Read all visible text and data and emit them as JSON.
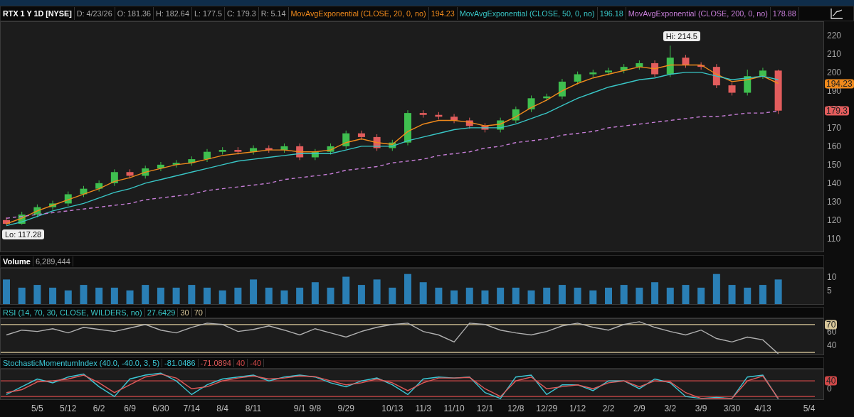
{
  "panes": [
    {
      "kind": "price",
      "legend": [
        {
          "kind": "title",
          "text": "RTX 1 Y 1D [NYSE]"
        },
        {
          "kind": "field",
          "text": "D: 4/23/26"
        },
        {
          "kind": "field",
          "text": "O: 181.36"
        },
        {
          "kind": "field",
          "text": "H: 182.64"
        },
        {
          "kind": "field",
          "text": "L: 177.5"
        },
        {
          "kind": "field",
          "text": "C: 179.3"
        },
        {
          "kind": "field",
          "text": "R: 5.14"
        },
        {
          "kind": "series",
          "text": "MovAvgExponential (CLOSE, 20, 0, no)"
        },
        {
          "kind": "value",
          "text": "194.23"
        },
        {
          "kind": "series",
          "text": "MovAvgExponential (CLOSE, 50, 0, no)"
        },
        {
          "kind": "value",
          "text": "196.18"
        },
        {
          "kind": "series",
          "text": "MovAvgExponential (CLOSE, 200, 0, no)"
        },
        {
          "kind": "value",
          "text": "178.88"
        }
      ],
      "chart_data": {
        "type": "candlestick",
        "ylim": [
          103,
          227.3
        ],
        "yticks": [
          110,
          120,
          130,
          140,
          150,
          160,
          170,
          180,
          190,
          200,
          210,
          220
        ],
        "categories": [
          null,
          null,
          null,
          null,
          null,
          null,
          null,
          null,
          null,
          null,
          null,
          null,
          null,
          null,
          null,
          null,
          null,
          null,
          null,
          null,
          null,
          null,
          null,
          null,
          null,
          null,
          null,
          null,
          null,
          null,
          null,
          null,
          null,
          null,
          null,
          null,
          null,
          null,
          null,
          null,
          null,
          null,
          null,
          null,
          null,
          null,
          null,
          null,
          null,
          null,
          null,
          null,
          null
        ],
        "ohlc": [
          [
            120,
            121.5,
            117.28,
            118
          ],
          [
            118,
            124.5,
            117.5,
            123
          ],
          [
            123,
            128.5,
            121.5,
            127
          ],
          [
            127,
            130.5,
            125.5,
            129
          ],
          [
            129,
            135.5,
            127.5,
            134
          ],
          [
            134,
            138.5,
            132.5,
            137
          ],
          [
            137,
            141.5,
            135.5,
            140
          ],
          [
            140,
            147.5,
            138.5,
            146
          ],
          [
            146,
            147.5,
            142.5,
            144
          ],
          [
            144,
            149.5,
            142.5,
            148
          ],
          [
            148,
            151.5,
            146.5,
            150
          ],
          [
            150,
            152.5,
            148.5,
            151
          ],
          [
            151,
            154.5,
            149.5,
            153
          ],
          [
            153,
            158.5,
            151.5,
            157
          ],
          [
            157,
            159.5,
            155.5,
            158
          ],
          [
            158,
            159.5,
            155.5,
            157
          ],
          [
            157,
            160.5,
            155.5,
            159
          ],
          [
            159,
            160.5,
            156.5,
            158
          ],
          [
            158,
            161.5,
            156.5,
            160
          ],
          [
            160,
            161.5,
            152.5,
            154
          ],
          [
            154,
            158.5,
            152.5,
            157
          ],
          [
            157,
            161.5,
            155.5,
            160
          ],
          [
            160,
            168.5,
            158.5,
            167
          ],
          [
            167,
            168.5,
            163.5,
            165
          ],
          [
            165,
            166.5,
            157.5,
            159
          ],
          [
            159,
            163.5,
            157.5,
            162
          ],
          [
            162,
            179.5,
            160.5,
            178
          ],
          [
            178,
            179.5,
            175.5,
            177
          ],
          [
            177,
            178.5,
            174.5,
            176
          ],
          [
            176,
            177.5,
            172.5,
            174
          ],
          [
            174,
            175.5,
            169.5,
            171
          ],
          [
            171,
            172.5,
            167.5,
            169
          ],
          [
            169,
            175.5,
            167.5,
            174
          ],
          [
            174,
            181.5,
            172.5,
            180
          ],
          [
            180,
            187.5,
            178.5,
            186
          ],
          [
            186,
            188.5,
            184.5,
            187
          ],
          [
            187,
            196.5,
            185.5,
            195
          ],
          [
            195,
            200.5,
            193.5,
            199
          ],
          [
            199,
            201.5,
            197.5,
            200
          ],
          [
            200,
            202.5,
            198.5,
            201
          ],
          [
            201,
            204.5,
            199.5,
            203
          ],
          [
            203,
            206.5,
            201.5,
            205
          ],
          [
            205,
            206.5,
            197.5,
            199
          ],
          [
            199,
            214.5,
            197.5,
            208
          ],
          [
            208,
            209.5,
            202.5,
            204
          ],
          [
            204,
            205.5,
            201.5,
            203
          ],
          [
            203,
            204.5,
            191.5,
            193
          ],
          [
            193,
            194.5,
            187.5,
            189
          ],
          [
            189,
            201.5,
            187.5,
            198
          ],
          [
            198,
            202.5,
            196.5,
            201
          ],
          [
            201,
            201.5,
            177.5,
            179.3
          ],
          null,
          null
        ],
        "annotations": [
          "Hi: 214.5",
          "Lo: 117.28",
          "194.23",
          "179.3"
        ]
      },
      "moving_averages": {
        "chart_data": {
          "type": "line",
          "ylim": [
            103,
            227.3
          ],
          "categories": [
            null,
            null,
            null,
            null,
            null,
            null,
            null,
            null,
            null,
            null,
            null,
            null,
            null,
            null,
            null,
            null,
            null,
            null,
            null,
            null,
            null,
            null,
            null,
            null,
            null,
            null,
            null,
            null,
            null,
            null,
            null,
            null,
            null,
            null,
            null,
            null,
            null,
            null,
            null,
            null,
            null,
            null,
            null,
            null,
            null,
            null,
            null,
            null,
            null,
            null,
            null,
            null,
            null
          ],
          "series": [
            {
              "color": "#f08a1c",
              "values": [
                118,
                121,
                125,
                128,
                131,
                134,
                137,
                141,
                143,
                146,
                148,
                150,
                151,
                153,
                155,
                156,
                157,
                158,
                158,
                157,
                157,
                158,
                162,
                164,
                162,
                161,
                168,
                172,
                174,
                174,
                173,
                171,
                172,
                176,
                181,
                185,
                190,
                194,
                197,
                199,
                201,
                203,
                202,
                204,
                204,
                204,
                199,
                195,
                196,
                198,
                194,
                null,
                null
              ]
            },
            {
              "color": "#39c6c6",
              "values": [
                117,
                119,
                122,
                125,
                127,
                129,
                132,
                135,
                137,
                140,
                142,
                144,
                146,
                148,
                150,
                152,
                153,
                154,
                155,
                156,
                156,
                156,
                158,
                160,
                160,
                160,
                163,
                165,
                167,
                169,
                170,
                170,
                170,
                172,
                175,
                178,
                182,
                186,
                189,
                192,
                194,
                196,
                197,
                199,
                200,
                200,
                198,
                196,
                197,
                198,
                196,
                null,
                null
              ]
            },
            {
              "color": "#c77ed8",
              "line_style": "dashed",
              "values": [
                121,
                122,
                123,
                124,
                125,
                126,
                127,
                128,
                129,
                131,
                132,
                133,
                134,
                136,
                137,
                138,
                139,
                140,
                142,
                143,
                144,
                145,
                147,
                148,
                149,
                151,
                152,
                153,
                155,
                156,
                157,
                159,
                160,
                162,
                163,
                164,
                166,
                167,
                168,
                170,
                171,
                172,
                173,
                174,
                175,
                176,
                176,
                177,
                178,
                178,
                179,
                null,
                null
              ]
            }
          ]
        }
      }
    },
    {
      "kind": "volume",
      "legend": [
        {
          "kind": "title",
          "text": "Volume"
        },
        {
          "kind": "field",
          "text": "6,289,444"
        }
      ],
      "chart_data": {
        "type": "bar",
        "ylim": [
          0,
          13
        ],
        "yticks": [
          5,
          10
        ],
        "categories": [
          null,
          null,
          null,
          null,
          null,
          null,
          null,
          null,
          null,
          null,
          null,
          null,
          null,
          null,
          null,
          null,
          null,
          null,
          null,
          null,
          null,
          null,
          null,
          null,
          null,
          null,
          null,
          null,
          null,
          null,
          null,
          null,
          null,
          null,
          null,
          null,
          null,
          null,
          null,
          null,
          null,
          null,
          null,
          null,
          null,
          null,
          null,
          null,
          null,
          null,
          null,
          null,
          null
        ],
        "series": [
          {
            "color": "#2a7fb5",
            "values": [
              9,
              6,
              7,
              6,
              5,
              7,
              6,
              6,
              5,
              7,
              6,
              6,
              7,
              6,
              5,
              6,
              9,
              6,
              5,
              6,
              8,
              6,
              10,
              7,
              9,
              6,
              11,
              8,
              6,
              5,
              6,
              5,
              6,
              6,
              5,
              6,
              7,
              6,
              5,
              6,
              7,
              6,
              8,
              6,
              7,
              6,
              11,
              7,
              6,
              7,
              9,
              null,
              null
            ]
          }
        ]
      }
    },
    {
      "kind": "rsi",
      "legend": [
        {
          "kind": "accent",
          "text": "RSI (14, 70, 30, CLOSE, WILDERS, no)"
        },
        {
          "kind": "accent",
          "text": "27.6429"
        },
        {
          "kind": "ref"
        },
        {
          "kind": "ref"
        }
      ],
      "chart_data": {
        "type": "line",
        "ylim": [
          27,
          78
        ],
        "yticks": [
          40,
          60,
          70
        ],
        "categories": [
          null,
          null,
          null,
          null,
          null,
          null,
          null,
          null,
          null,
          null,
          null,
          null,
          null,
          null,
          null,
          null,
          null,
          null,
          null,
          null,
          null,
          null,
          null,
          null,
          null,
          null,
          null,
          null,
          null,
          null,
          null,
          null,
          null,
          null,
          null,
          null,
          null,
          null,
          null,
          null,
          null,
          null,
          null,
          null,
          null,
          null,
          null,
          null,
          null,
          null,
          null,
          null,
          null
        ],
        "series": [
          {
            "color": "#b0b0b0",
            "values": [
              55,
              62,
              60,
              64,
              58,
              66,
              63,
              60,
              65,
              70,
              62,
              58,
              66,
              72,
              70,
              60,
              63,
              68,
              62,
              55,
              64,
              58,
              52,
              60,
              66,
              70,
              72,
              60,
              55,
              45,
              72,
              70,
              62,
              58,
              55,
              60,
              68,
              72,
              66,
              62,
              70,
              74,
              66,
              60,
              55,
              62,
              50,
              45,
              52,
              48,
              28,
              null,
              null
            ]
          }
        ],
        "ref_lines": [
          {
            "axis": "y",
            "value": 30,
            "label": "30",
            "color": "#d8c79a"
          },
          {
            "axis": "y",
            "value": 70,
            "label": "70",
            "color": "#d8c79a"
          }
        ]
      }
    },
    {
      "kind": "smi",
      "legend": [
        {
          "kind": "series",
          "text": "StochasticMomentumIndex (40.0, -40.0, 3, 5)"
        },
        {
          "kind": "value",
          "text": "-81.0486"
        },
        {
          "kind": "value",
          "text": "-71.0894"
        },
        {
          "kind": "ref"
        },
        {
          "kind": "ref"
        }
      ],
      "chart_data": {
        "type": "line",
        "ylim": [
          -54,
          99
        ],
        "yticks": [
          0,
          40
        ],
        "categories": [
          null,
          null,
          "5/5",
          null,
          "5/12",
          null,
          "6/2",
          null,
          "6/9",
          null,
          "6/30",
          null,
          "7/14",
          null,
          "8/4",
          null,
          "8/11",
          null,
          null,
          "9/1",
          "9/8",
          null,
          "9/29",
          null,
          null,
          "10/13",
          null,
          "11/3",
          null,
          "11/10",
          null,
          "12/1",
          null,
          "12/8",
          null,
          "12/29",
          null,
          "1/12",
          null,
          "2/2",
          null,
          "2/9",
          null,
          "3/2",
          null,
          "3/9",
          null,
          "3/30",
          null,
          "4/13",
          null,
          null,
          "5/4"
        ],
        "series": [
          {
            "color": "#3cc8d6",
            "values": [
              -30,
              10,
              50,
              30,
              60,
              75,
              10,
              -40,
              50,
              70,
              80,
              40,
              -30,
              20,
              50,
              60,
              70,
              40,
              60,
              70,
              60,
              30,
              10,
              40,
              55,
              20,
              -30,
              50,
              60,
              55,
              60,
              -20,
              -50,
              60,
              70,
              -30,
              20,
              20,
              -10,
              40,
              40,
              0,
              50,
              30,
              -40,
              -50,
              -45,
              -50,
              60,
              70,
              -52,
              null,
              null
            ]
          },
          {
            "color": "#e05a5a",
            "values": [
              -20,
              -5,
              35,
              40,
              50,
              70,
              30,
              -20,
              20,
              60,
              75,
              55,
              0,
              10,
              40,
              55,
              65,
              50,
              55,
              65,
              62,
              40,
              20,
              30,
              50,
              30,
              -10,
              30,
              55,
              55,
              58,
              0,
              -40,
              40,
              60,
              0,
              10,
              20,
              0,
              30,
              40,
              10,
              40,
              35,
              -20,
              -50,
              -49,
              -50,
              40,
              65,
              -50,
              null,
              null
            ]
          }
        ],
        "ref_lines": [
          {
            "axis": "y",
            "value": 40,
            "label": "40",
            "color": "#d04848"
          },
          {
            "axis": "y",
            "value": -40,
            "label": "-40",
            "color": "#d04848"
          }
        ]
      }
    }
  ]
}
